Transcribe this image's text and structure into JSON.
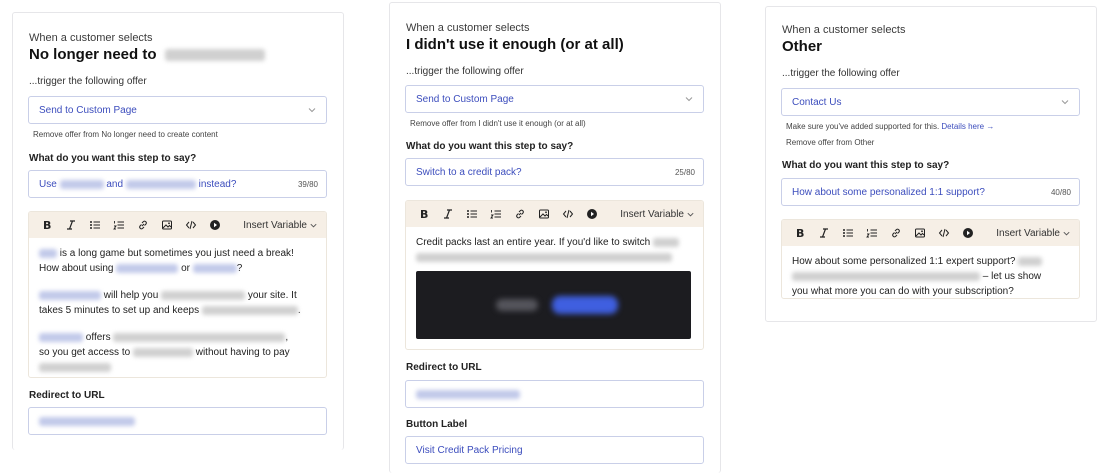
{
  "card1": {
    "eyebrow": "When a customer selects",
    "title": "No longer need to",
    "trigger_label": "...trigger the following offer",
    "offer_select": "Send to Custom Page",
    "remove_note": "Remove offer from No longer need to create content",
    "step_label": "What do you want this step to say?",
    "headline_prefix": "Use",
    "headline_mid": "and",
    "headline_suffix": "instead?",
    "headline_counter": "39/80",
    "insert_variable": "Insert Variable",
    "body_line1_tail": "is a long game but sometimes you just need a break!",
    "body_line2_head": "How about using",
    "body_line2_mid": "or",
    "body_line2_tail": "?",
    "body_p2_mid": "will help you",
    "body_p2_tail": "your site. It",
    "body_p2_line2": "takes 5 minutes to set up and keeps",
    "body_p2_end": ".",
    "body_p3_mid": "offers",
    "body_p3_end": ",",
    "body_p3_line2": "so you get access to",
    "body_p3_line2_tail": "without having to pay",
    "redirect_label": "Redirect to URL"
  },
  "card2": {
    "eyebrow": "When a customer selects",
    "title": "I didn't use it enough (or at all)",
    "trigger_label": "...trigger the following offer",
    "offer_select": "Send to Custom Page",
    "remove_note": "Remove offer from I didn't use it enough (or at all)",
    "step_label": "What do you want this step to say?",
    "headline": "Switch to a credit pack?",
    "headline_counter": "25/80",
    "insert_variable": "Insert Variable",
    "body_line1": "Credit packs last an entire year. If you'd like to switch",
    "redirect_label": "Redirect to URL",
    "button_label_label": "Button Label",
    "button_label_value": "Visit Credit Pack Pricing"
  },
  "card3": {
    "eyebrow": "When a customer selects",
    "title": "Other",
    "trigger_label": "...trigger the following offer",
    "offer_select": "Contact Us",
    "support_note": "Make sure you've added supported for this.",
    "support_link": "Details here →",
    "remove_note": "Remove offer from Other",
    "step_label": "What do you want this step to say?",
    "headline": "How about some personalized 1:1 support?",
    "headline_counter": "40/80",
    "insert_variable": "Insert Variable",
    "body_line1": "How about some personalized 1:1 expert support?",
    "body_line2_tail": "– let us show",
    "body_line3": "you what more you can do with your subscription?"
  },
  "colors": {
    "accent": "#3c4dbd",
    "toolbar_bg": "#f6efe6",
    "field_border": "#c9cfe8"
  },
  "icons": [
    "bold-icon",
    "italic-icon",
    "bullet-list-icon",
    "numbered-list-icon",
    "link-icon",
    "image-icon",
    "code-icon",
    "play-icon",
    "chevron-down-icon"
  ]
}
